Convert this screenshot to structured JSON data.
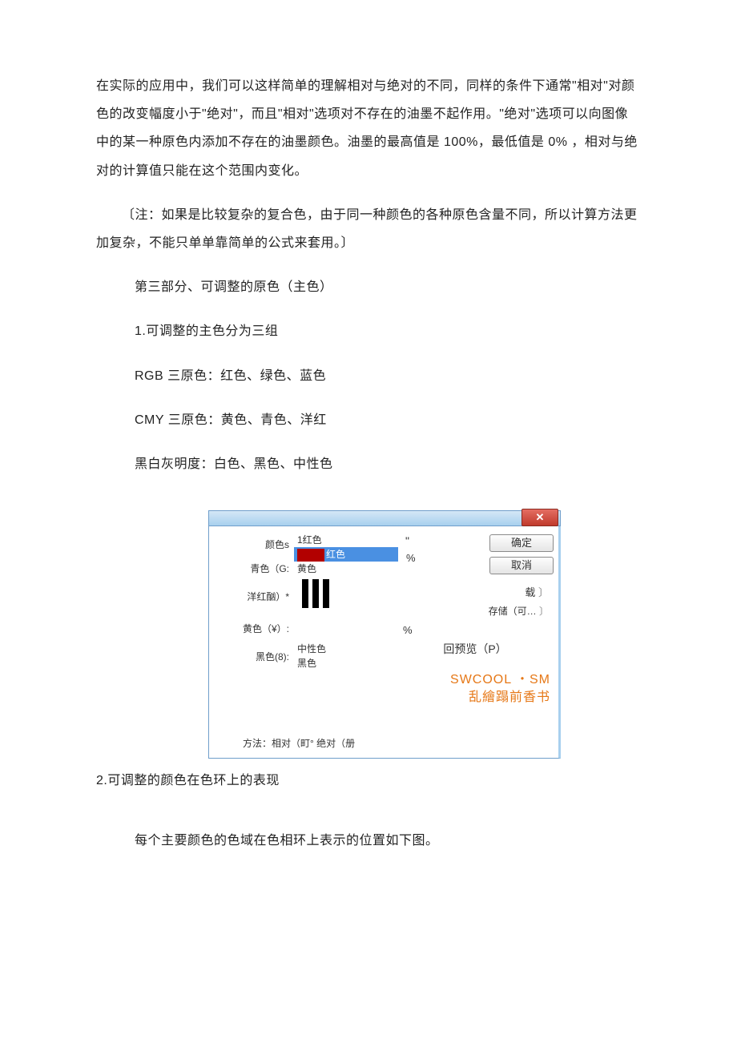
{
  "body": {
    "p1": "在实际的应用中，我们可以这样简单的理解相对与绝对的不同，同样的条件下通常\"相对\"对颜色的改变幅度小于\"绝对\"，而且\"相对\"选项对不存在的油墨不起作用。\"绝对\"选项可以向图像中的某一种原色内添加不存在的油墨颜色。油墨的最高值是 100%，最低值是 0% ，相对与绝对的计算值只能在这个范围内变化。",
    "note": "〔注：如果是比较复杂的复合色，由于同一种颜色的各种原色含量不同，所以计算方法更加复杂，不能只单单靠简单的公式来套用。〕",
    "section3_title": "第三部分、可调整的原色（主色）",
    "s3_1": "1.可调整的主色分为三组",
    "rgb_line": "RGB 三原色：红色、绿色、蓝色",
    "cmy_line": "CMY 三原色：黄色、青色、洋红",
    "bw_line": "黑白灰明度：白色、黑色、中性色",
    "s3_2": "2.可调整的颜色在色环上的表现",
    "s3_2_desc": "每个主要颜色的色域在色相环上表示的位置如下图。"
  },
  "dialog": {
    "close_glyph": "✕",
    "left": {
      "colors": "颜色s",
      "cyan": "青色（G:",
      "magenta": "洋红酗）*",
      "yellow": "黄色（¥）:",
      "black": "黑色(8):"
    },
    "options": {
      "o1": "1红色",
      "o2": "红色",
      "o3": "黄色",
      "o4": "中性色",
      "o5": "黑色"
    },
    "quote": "\"",
    "pct": "%",
    "buttons": {
      "ok": "确定",
      "cancel": "取消",
      "load": "载",
      "save": "存储（可…",
      "preview": "回预览（P）"
    },
    "method": "方法：相对（町° 绝对（册",
    "watermark1": "SWCOOL ・SM",
    "watermark2": "乱繪蹋前香书"
  }
}
